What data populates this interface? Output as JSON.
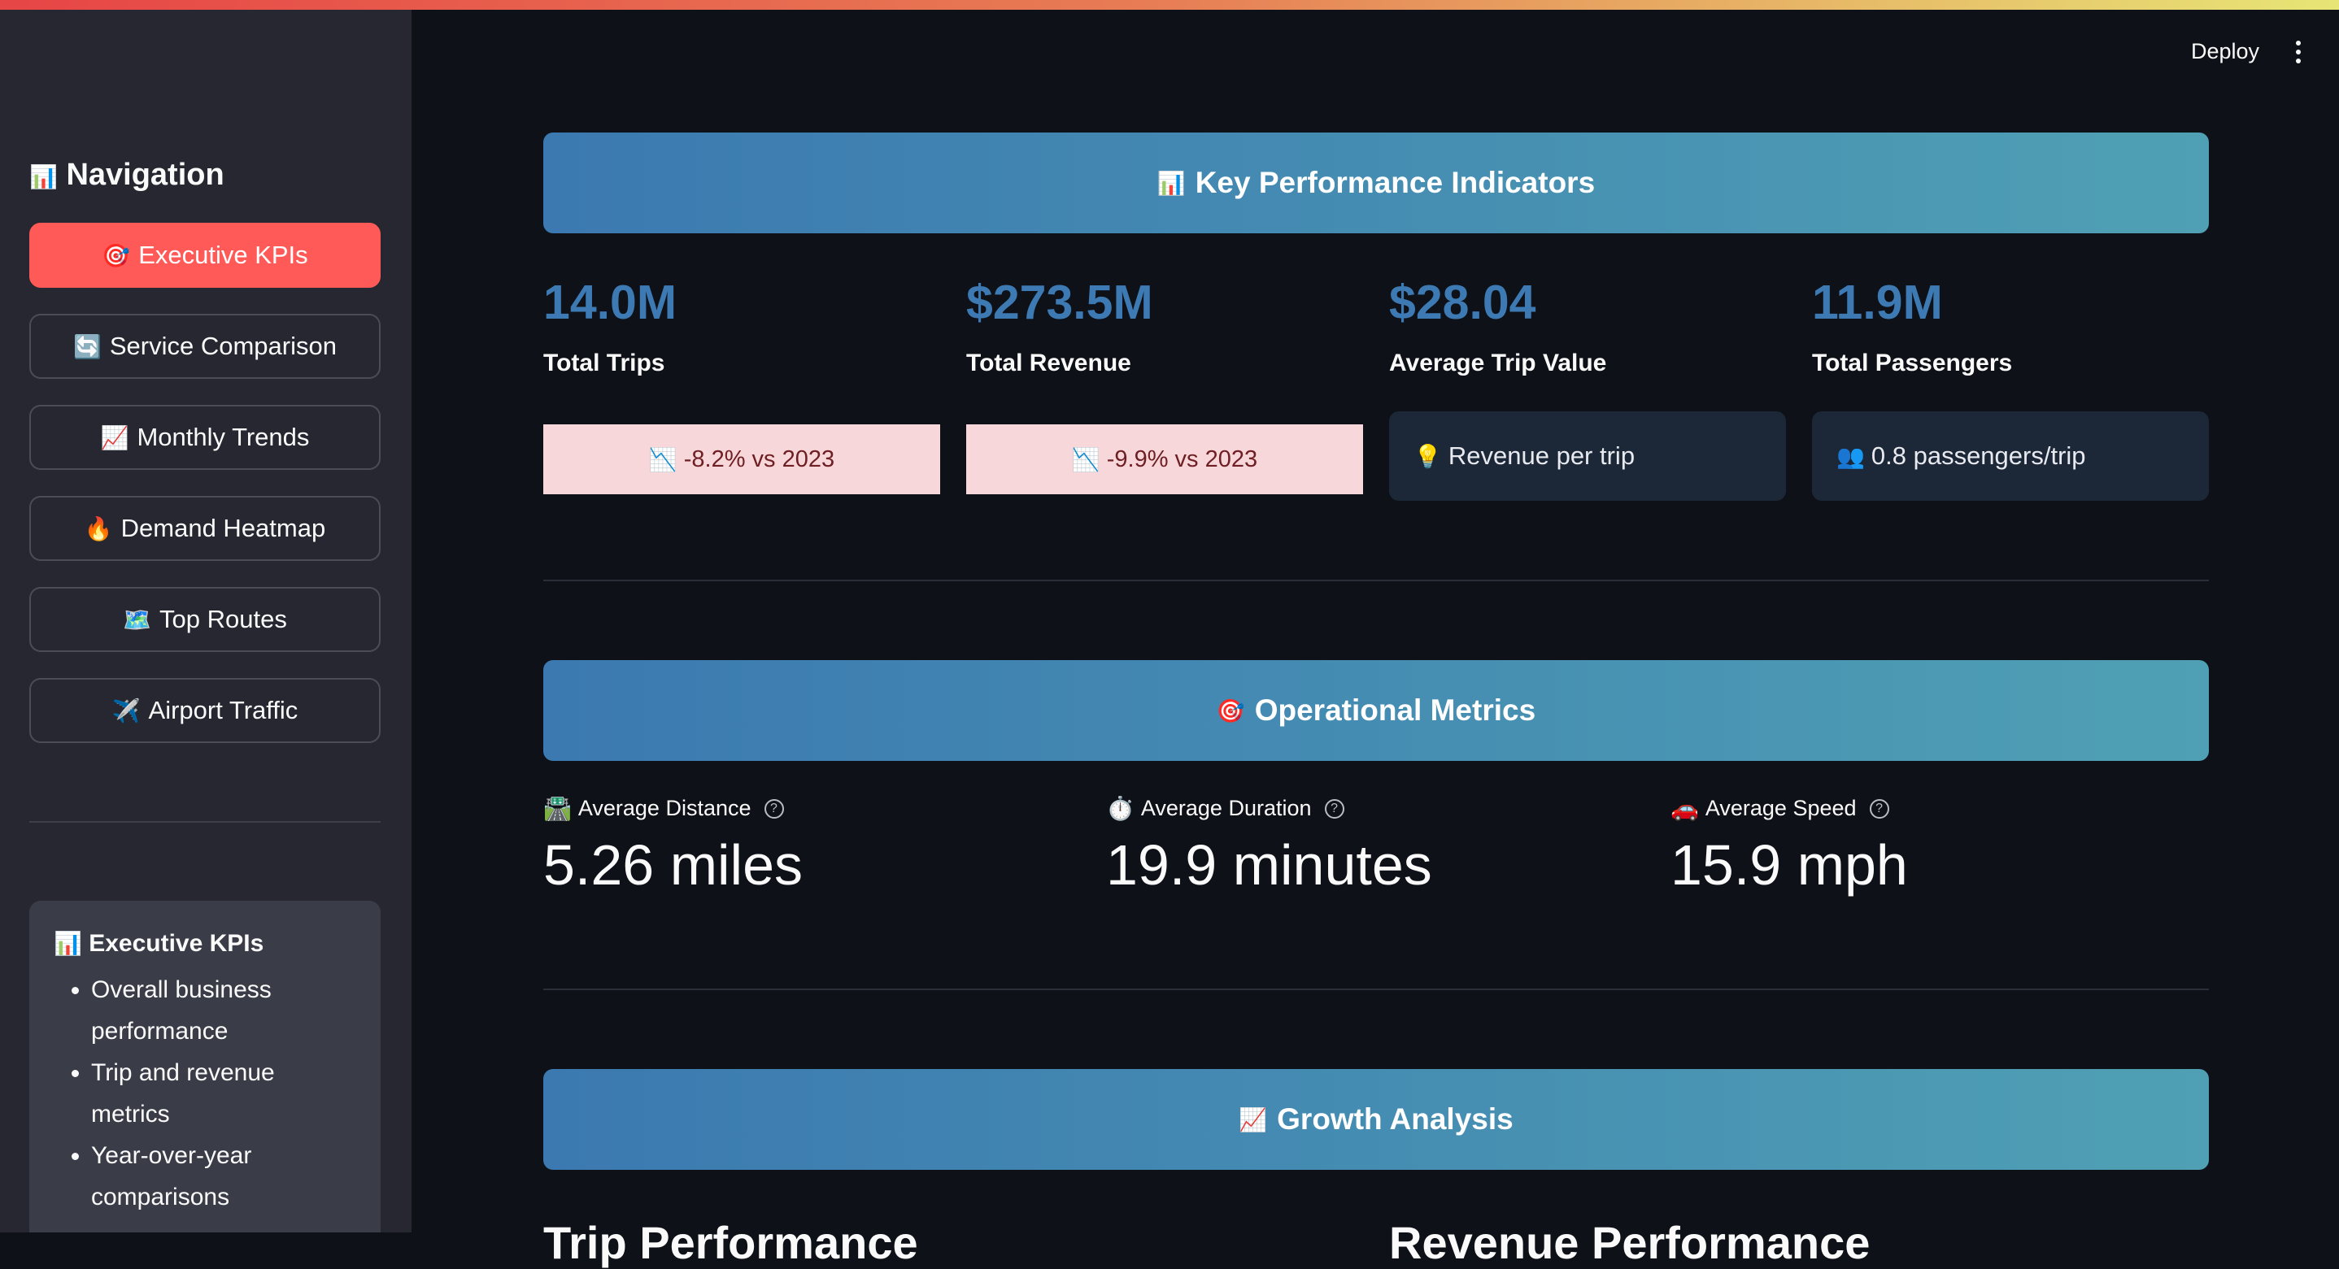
{
  "header": {
    "deploy_label": "Deploy"
  },
  "sidebar": {
    "nav_title": "Navigation",
    "nav_title_icon": "📊",
    "items": [
      {
        "icon": "🎯",
        "label": "Executive KPIs",
        "active": true
      },
      {
        "icon": "🔄",
        "label": "Service Comparison"
      },
      {
        "icon": "📈",
        "label": "Monthly Trends"
      },
      {
        "icon": "🔥",
        "label": "Demand Heatmap"
      },
      {
        "icon": "🗺️",
        "label": "Top Routes"
      },
      {
        "icon": "✈️",
        "label": "Airport Traffic"
      }
    ],
    "info": {
      "icon": "📊",
      "title": "Executive KPIs",
      "bullets": [
        "Overall business performance",
        "Trip and revenue metrics",
        "Year-over-year comparisons"
      ]
    }
  },
  "kpi": {
    "banner_icon": "📊",
    "banner": "Key Performance Indicators",
    "cards": [
      {
        "value": "14.0M",
        "label": "Total Trips",
        "note_icon": "📉",
        "note": "-8.2% vs 2023"
      },
      {
        "value": "$273.5M",
        "label": "Total Revenue",
        "note_icon": "📉",
        "note": "-9.9% vs 2023"
      },
      {
        "value": "$28.04",
        "label": "Average Trip Value",
        "note_icon": "💡",
        "note": "Revenue per trip"
      },
      {
        "value": "11.9M",
        "label": "Total Passengers",
        "note_icon": "👥",
        "note": "0.8 passengers/trip"
      }
    ]
  },
  "ops": {
    "banner_icon": "🎯",
    "banner": "Operational Metrics",
    "metrics": [
      {
        "icon": "🛣️",
        "label": "Average Distance",
        "value": "5.26 miles"
      },
      {
        "icon": "⏱️",
        "label": "Average Duration",
        "value": "19.9 minutes"
      },
      {
        "icon": "🚗",
        "label": "Average Speed",
        "value": "15.9 mph"
      }
    ]
  },
  "growth": {
    "banner_icon": "📈",
    "banner": "Growth Analysis",
    "left_heading": "Trip Performance",
    "right_heading": "Revenue Performance"
  }
}
